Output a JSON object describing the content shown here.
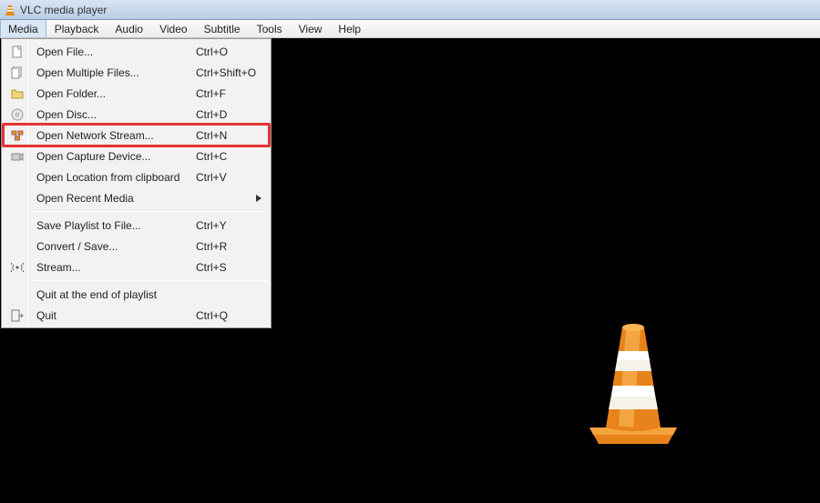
{
  "titlebar": {
    "title": "VLC media player"
  },
  "menubar": {
    "items": [
      {
        "label": "Media",
        "open": true
      },
      {
        "label": "Playback"
      },
      {
        "label": "Audio"
      },
      {
        "label": "Video"
      },
      {
        "label": "Subtitle"
      },
      {
        "label": "Tools"
      },
      {
        "label": "View"
      },
      {
        "label": "Help"
      }
    ]
  },
  "dropdown": {
    "items": [
      {
        "type": "item",
        "icon": "file-icon",
        "label": "Open File...",
        "shortcut": "Ctrl+O"
      },
      {
        "type": "item",
        "icon": "files-icon",
        "label": "Open Multiple Files...",
        "shortcut": "Ctrl+Shift+O"
      },
      {
        "type": "item",
        "icon": "folder-icon",
        "label": "Open Folder...",
        "shortcut": "Ctrl+F"
      },
      {
        "type": "item",
        "icon": "disc-icon",
        "label": "Open Disc...",
        "shortcut": "Ctrl+D"
      },
      {
        "type": "item",
        "icon": "network-icon",
        "label": "Open Network Stream...",
        "shortcut": "Ctrl+N",
        "highlight": "red"
      },
      {
        "type": "item",
        "icon": "capture-icon",
        "label": "Open Capture Device...",
        "shortcut": "Ctrl+C"
      },
      {
        "type": "item",
        "icon": "",
        "label": "Open Location from clipboard",
        "shortcut": "Ctrl+V"
      },
      {
        "type": "item",
        "icon": "",
        "label": "Open Recent Media",
        "shortcut": "",
        "submenu": true
      },
      {
        "type": "separator"
      },
      {
        "type": "item",
        "icon": "",
        "label": "Save Playlist to File...",
        "shortcut": "Ctrl+Y"
      },
      {
        "type": "item",
        "icon": "",
        "label": "Convert / Save...",
        "shortcut": "Ctrl+R"
      },
      {
        "type": "item",
        "icon": "stream-icon",
        "label": "Stream...",
        "shortcut": "Ctrl+S"
      },
      {
        "type": "separator"
      },
      {
        "type": "item",
        "icon": "",
        "label": "Quit at the end of playlist",
        "shortcut": ""
      },
      {
        "type": "item",
        "icon": "quit-icon",
        "label": "Quit",
        "shortcut": "Ctrl+Q"
      }
    ]
  }
}
